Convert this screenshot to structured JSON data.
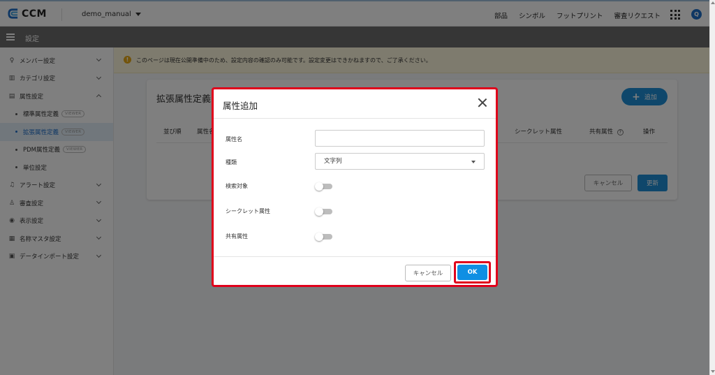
{
  "header": {
    "logo_text": "CCM",
    "project": "demo_manual",
    "nav": [
      "部品",
      "シンボル",
      "フットプリント",
      "審査リクエスト"
    ],
    "avatar_letter": "Q",
    "brand_color": "#1e6fc9"
  },
  "settings_bar": {
    "title": "設定"
  },
  "sidebar": {
    "items": [
      {
        "label": "メンバー設定",
        "icon": "person-icon"
      },
      {
        "label": "カテゴリ設定",
        "icon": "category-icon"
      },
      {
        "label": "属性設定",
        "icon": "list-icon"
      },
      {
        "label": "アラート設定",
        "icon": "bell-icon"
      },
      {
        "label": "審査設定",
        "icon": "review-icon"
      },
      {
        "label": "表示設定",
        "icon": "eye-icon"
      },
      {
        "label": "名称マスタ設定",
        "icon": "table-icon"
      },
      {
        "label": "データインポート設定",
        "icon": "import-icon"
      }
    ],
    "sub_items": [
      {
        "label": "標準属性定義",
        "badge": "VIEWER"
      },
      {
        "label": "拡張属性定義",
        "badge": "VIEWER"
      },
      {
        "label": "PDM属性定義",
        "badge": "VIEWER"
      },
      {
        "label": "単位設定"
      }
    ]
  },
  "notice": {
    "text": "このページは現在公開準備中のため、設定内容の確認のみ可能です。設定変更はできかねますので、ご了承ください。",
    "icon": "warning-icon"
  },
  "card": {
    "title": "拡張属性定義",
    "add_label": "追加",
    "columns": {
      "order": "並び順",
      "name": "属性名",
      "secret": "シークレット属性",
      "shared": "共有属性",
      "actions": "操作"
    },
    "cancel_label": "キャンセル",
    "update_label": "更新"
  },
  "modal": {
    "title": "属性追加",
    "fields": {
      "name_label": "属性名",
      "name_value": "",
      "type_label": "種類",
      "type_value": "文字列",
      "search_label": "検索対象",
      "secret_label": "シークレット属性",
      "shared_label": "共有属性"
    },
    "toggles": {
      "search": false,
      "secret": false,
      "shared": false
    },
    "cancel_label": "キャンセル",
    "ok_label": "OK",
    "highlight_color": "#e0001b",
    "primary_color": "#0f8fe3"
  }
}
